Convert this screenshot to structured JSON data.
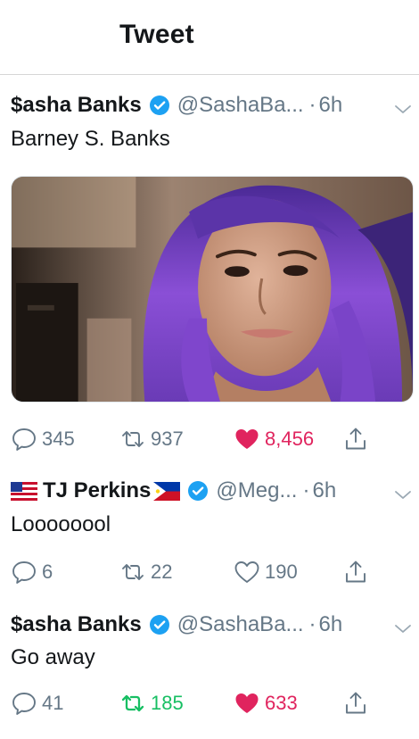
{
  "header": {
    "title": "Tweet"
  },
  "tweets": [
    {
      "display_name": "$asha Banks",
      "handle": "@SashaBa...",
      "separator": "·",
      "time": "6h",
      "text": "Barney S. Banks",
      "has_media": true,
      "replies": "345",
      "retweets": "937",
      "likes": "8,456",
      "liked": true,
      "retweeted": false
    },
    {
      "display_name": "TJ Perkins",
      "handle": "@Meg...",
      "separator": "·",
      "time": "6h",
      "text": "Loooooool",
      "flags": [
        "us-flag",
        "philippines-flag"
      ],
      "replies": "6",
      "retweets": "22",
      "likes": "190",
      "liked": false,
      "retweeted": false
    },
    {
      "display_name": "$asha Banks",
      "handle": "@SashaBa...",
      "separator": "·",
      "time": "6h",
      "text": "Go away",
      "replies": "41",
      "retweets": "185",
      "likes": "633",
      "liked": true,
      "retweeted": true
    }
  ],
  "colors": {
    "verified": "#1da1f2",
    "like": "#e0245e",
    "retweet": "#17bf63",
    "muted": "#657786",
    "text": "#14171a",
    "hair": "#8a4fd6"
  },
  "icons": [
    "verified-badge-icon",
    "chevron-down-icon",
    "reply-icon",
    "retweet-icon",
    "heart-icon",
    "share-icon"
  ]
}
